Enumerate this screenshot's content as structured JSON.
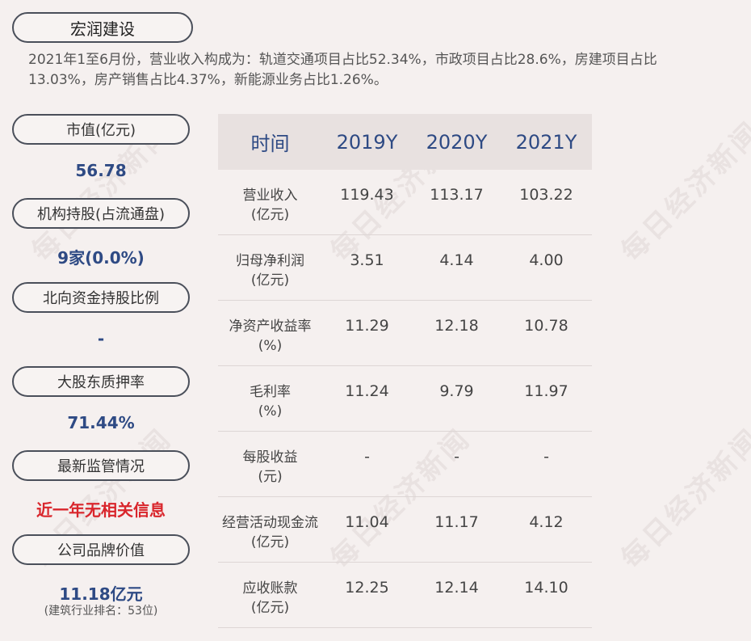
{
  "company": "宏润建设",
  "summary": "2021年1至6月份，营业收入构成为：轨道交通项目占比52.34%，市政项目占比28.6%，房建项目占比13.03%，房产销售占比4.37%，新能源业务占比1.26%。",
  "sidebar": [
    {
      "label": "市值(亿元)",
      "value": "56.78",
      "sub": ""
    },
    {
      "label": "机构持股(占流通盘)",
      "value": "9家(0.0%)",
      "sub": ""
    },
    {
      "label": "北向资金持股比例",
      "value": "-",
      "sub": ""
    },
    {
      "label": "大股东质押率",
      "value": "71.44%",
      "sub": ""
    },
    {
      "label": "最新监管情况",
      "value": "近一年无相关信息",
      "sub": ""
    },
    {
      "label": "公司品牌价值",
      "value": "11.18亿元",
      "sub": "(建筑行业排名：53位)"
    }
  ],
  "table": {
    "headers": [
      "时间",
      "2019Y",
      "2020Y",
      "2021Y"
    ],
    "rows": [
      {
        "label1": "营业收入",
        "label2": "(亿元)",
        "v": [
          "119.43",
          "113.17",
          "103.22"
        ]
      },
      {
        "label1": "归母净利润",
        "label2": "(亿元)",
        "v": [
          "3.51",
          "4.14",
          "4.00"
        ]
      },
      {
        "label1": "净资产收益率",
        "label2": "(%)",
        "v": [
          "11.29",
          "12.18",
          "10.78"
        ]
      },
      {
        "label1": "毛利率",
        "label2": "(%)",
        "v": [
          "11.24",
          "9.79",
          "11.97"
        ]
      },
      {
        "label1": "每股收益",
        "label2": "(元)",
        "v": [
          "-",
          "-",
          "-"
        ]
      },
      {
        "label1": "经营活动现金流",
        "label2": "(亿元)",
        "v": [
          "11.04",
          "11.17",
          "4.12"
        ]
      },
      {
        "label1": "应收账款",
        "label2": "(亿元)",
        "v": [
          "12.25",
          "12.14",
          "14.10"
        ]
      }
    ]
  },
  "watermark": "每日经济新闻",
  "colors": {
    "accent": "#2e4a84",
    "alert": "#d9262c",
    "background": "#f5f0ef"
  }
}
